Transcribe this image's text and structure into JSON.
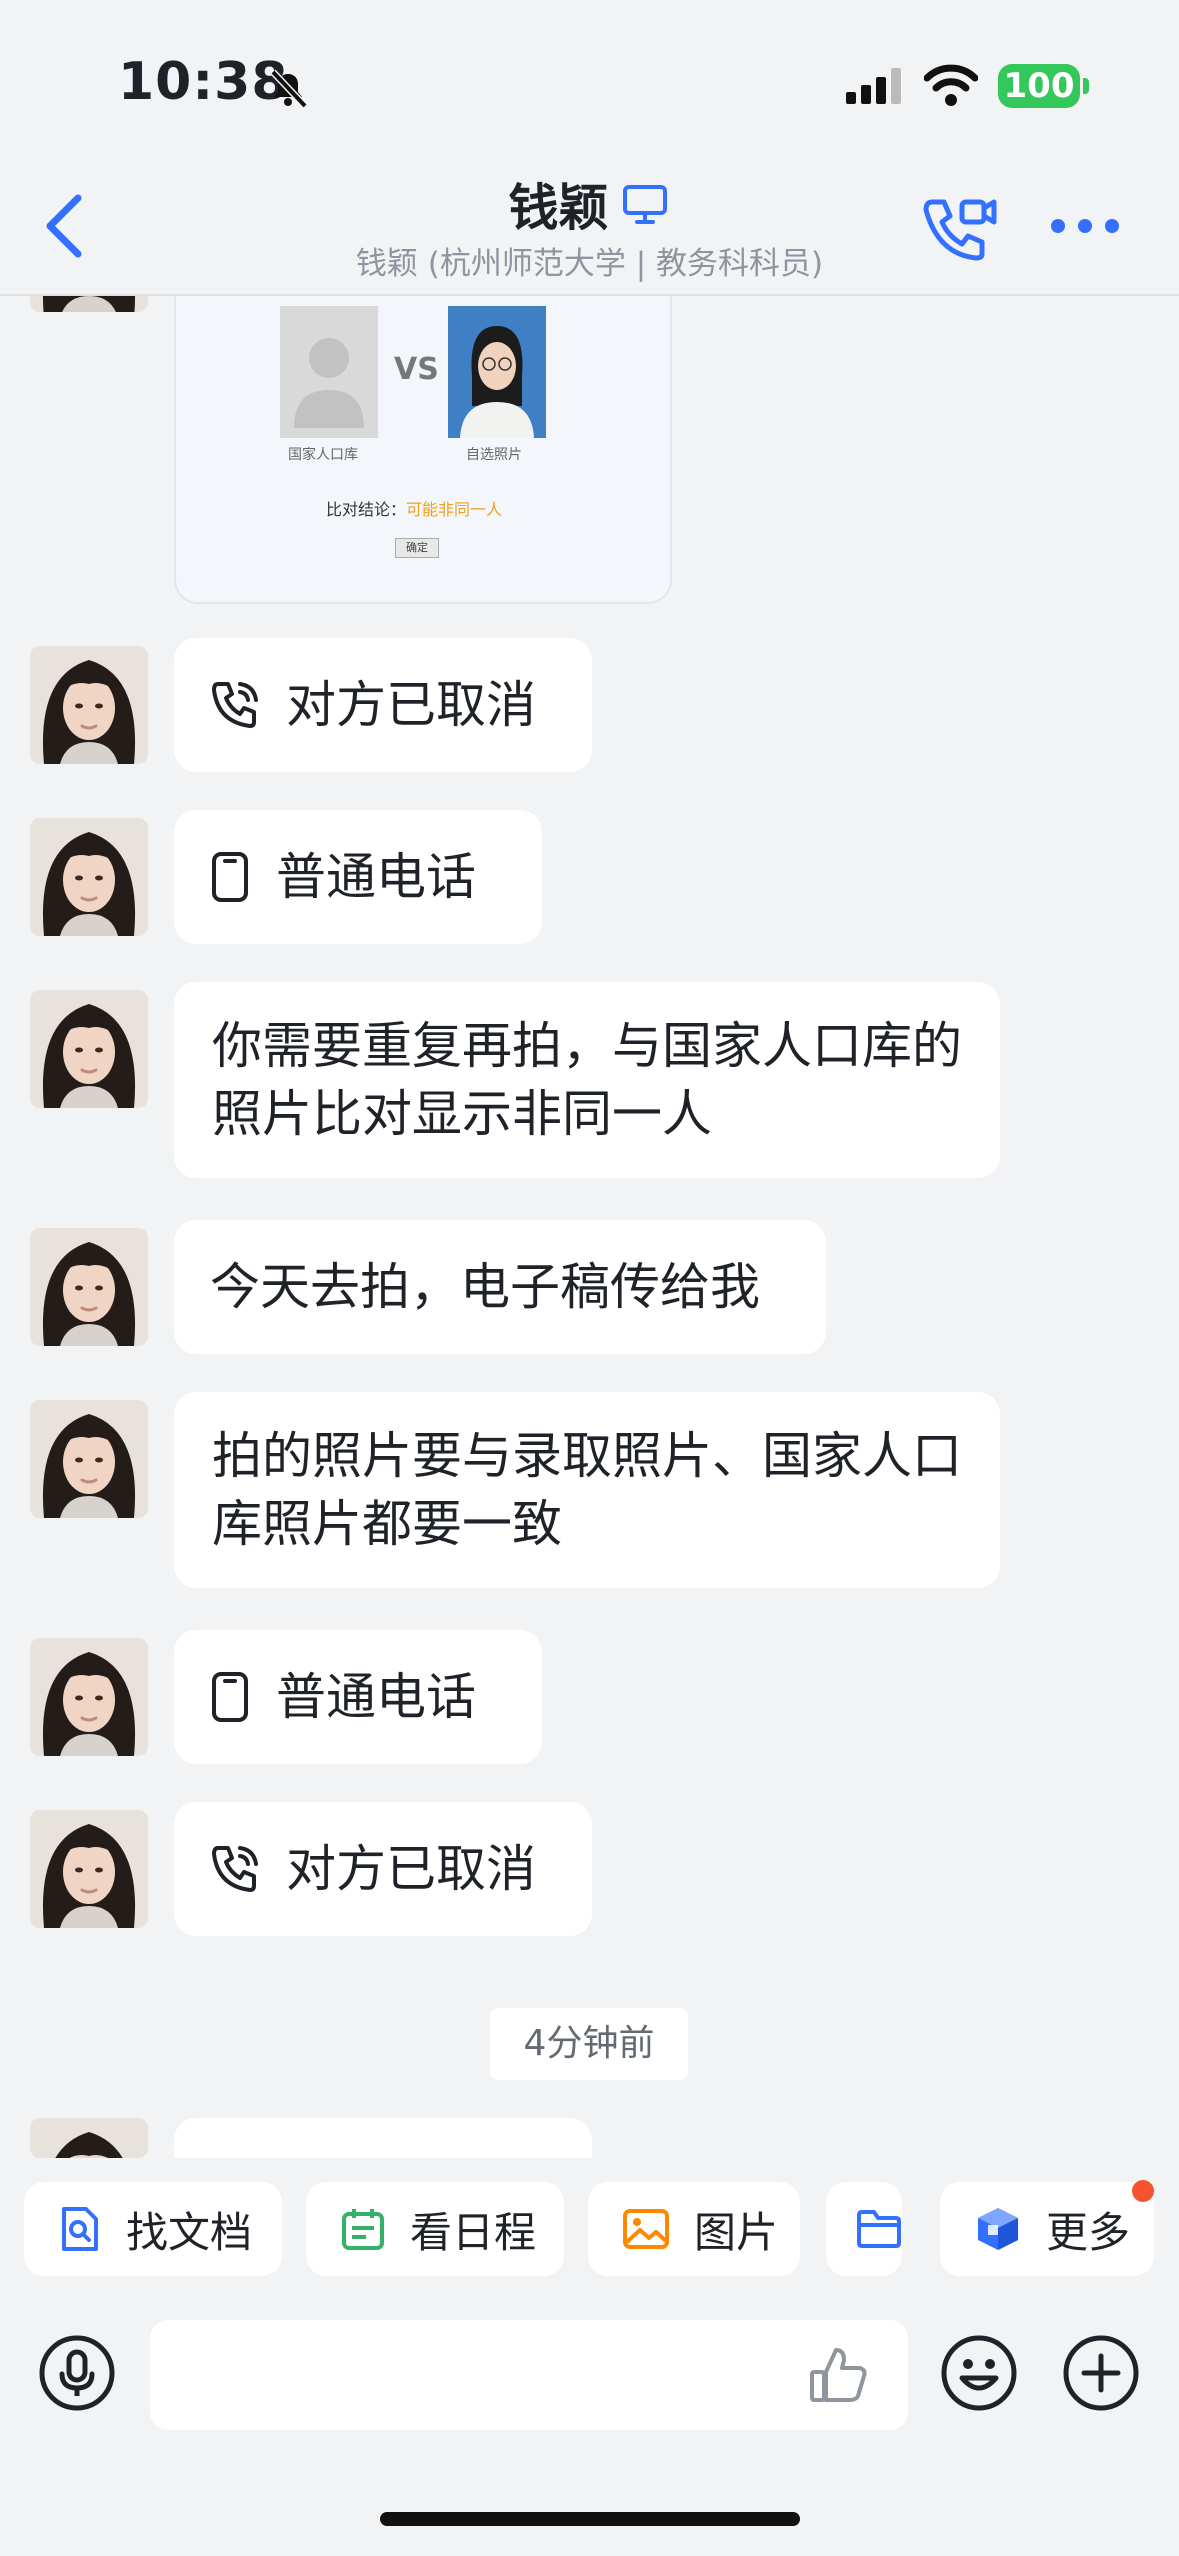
{
  "status_bar": {
    "time": "10:38",
    "battery": "100"
  },
  "header": {
    "name": "钱颖",
    "subtitle": "钱颖 (杭州师范大学 | 教务科科员)"
  },
  "photo_card": {
    "left_caption": "国家人口库",
    "vs": "VS",
    "right_caption": "自选照片",
    "result_label": "比对结论：",
    "result_value": "可能非同一人",
    "ok_button": "确定"
  },
  "messages": [
    {
      "type": "call",
      "icon": "call-cancel-icon",
      "text": "对方已取消"
    },
    {
      "type": "call",
      "icon": "phone-icon",
      "text": "普通电话"
    },
    {
      "type": "text",
      "text": "你需要重复再拍，与国家人口库的照片比对显示非同一人"
    },
    {
      "type": "text",
      "text": "今天去拍，电子稿传给我"
    },
    {
      "type": "text",
      "text": "拍的照片要与录取照片、国家人口库照片都要一致"
    },
    {
      "type": "call",
      "icon": "phone-icon",
      "text": "普通电话"
    },
    {
      "type": "call",
      "icon": "call-cancel-icon",
      "text": "对方已取消"
    }
  ],
  "time_divider": "4分钟前",
  "quick_actions": [
    {
      "label": "找文档",
      "icon": "doc-search-icon",
      "color": "#3370ff"
    },
    {
      "label": "看日程",
      "icon": "calendar-icon",
      "color": "#34b26b"
    },
    {
      "label": "图片",
      "icon": "image-icon",
      "color": "#ff8800"
    },
    {
      "label": "",
      "icon": "folder-icon",
      "color": "#3370ff"
    },
    {
      "label": "更多",
      "icon": "cube-icon",
      "color": "#3370ff"
    }
  ],
  "colors": {
    "accent": "#3370ff",
    "background": "#f2f3f5",
    "notification": "#f5532d"
  }
}
